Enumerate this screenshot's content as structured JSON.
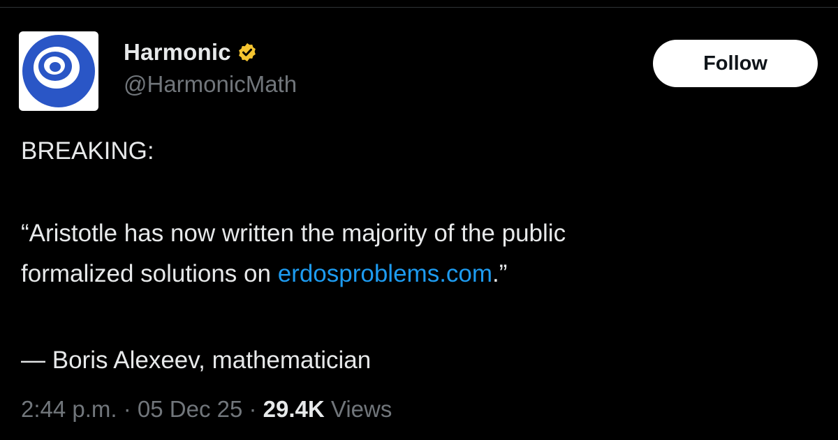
{
  "author": {
    "display_name": "Harmonic",
    "handle": "@HarmonicMath",
    "avatar_icon": "harmonic-logo",
    "verified_icon": "verified-badge-icon",
    "verified_color": "#F4C430"
  },
  "follow_label": "Follow",
  "tweet": {
    "line1": "BREAKING:",
    "quote_part1": "“Aristotle has now written the majority of the public",
    "quote_part2_prefix": "formalized solutions on ",
    "link_text": "erdosproblems.com",
    "quote_part2_suffix": ".”",
    "attribution": "— Boris Alexeev, mathematician"
  },
  "meta": {
    "time": "2:44 p.m.",
    "separator": " · ",
    "date": "05 Dec 25",
    "views_count": "29.4K",
    "views_label": "Views"
  },
  "colors": {
    "background": "#000000",
    "text": "#e7e9ea",
    "secondary_text": "#71767b",
    "link": "#1d9bf0",
    "logo_blue": "#2a56c6"
  }
}
